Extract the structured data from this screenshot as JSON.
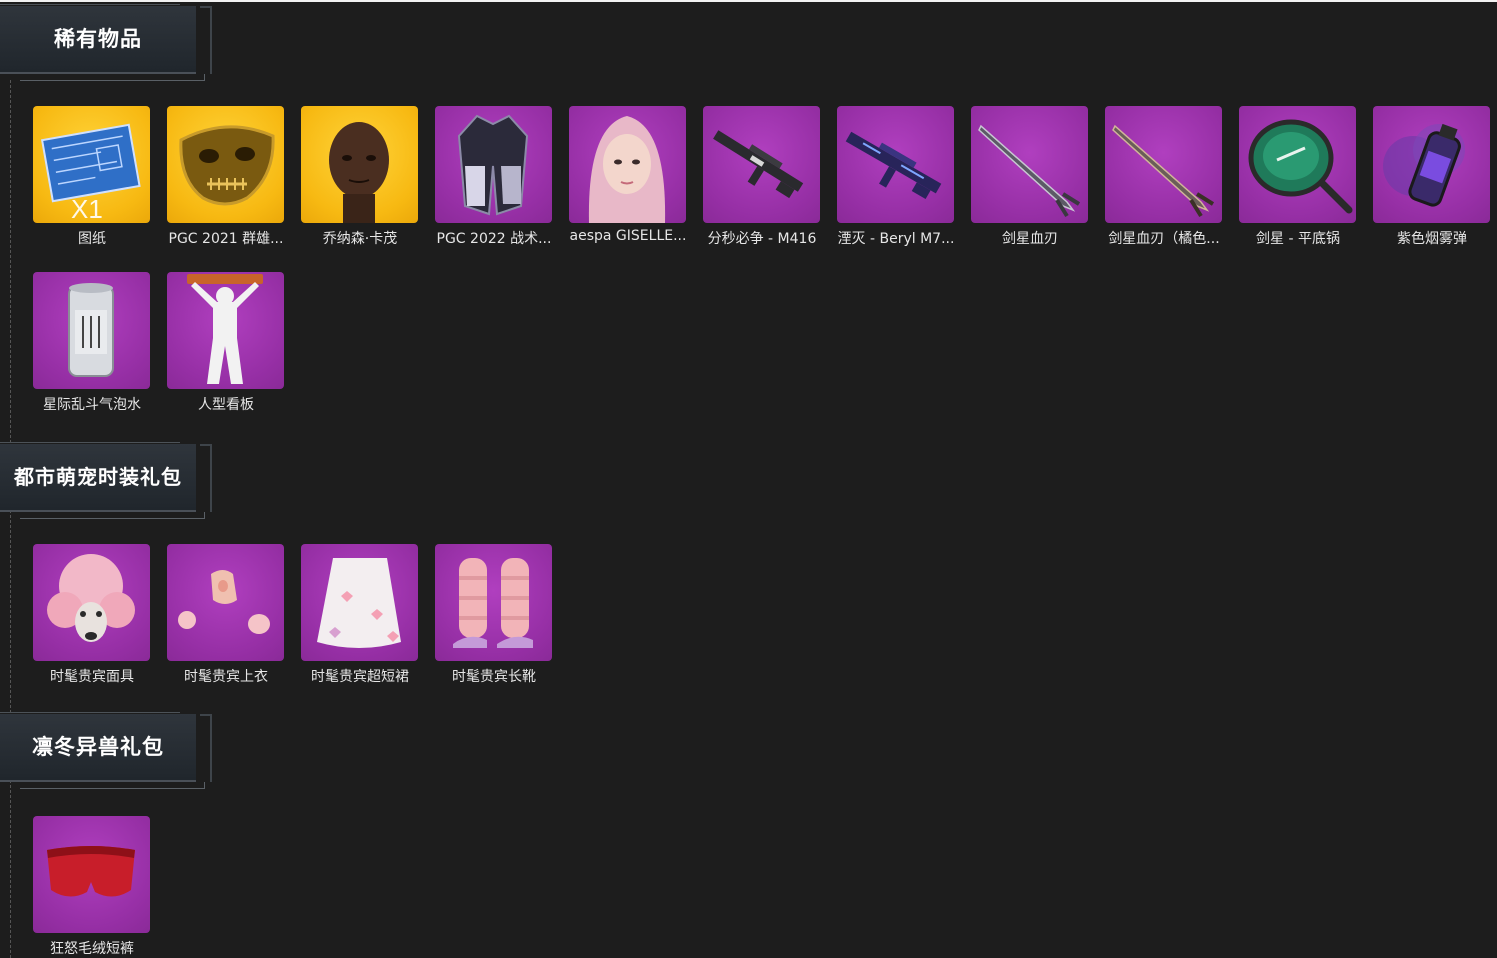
{
  "sections": [
    {
      "title": "稀有物品",
      "items": [
        {
          "label": "图纸",
          "icon": "blueprint-icon",
          "bg": "gold",
          "qty": "X1"
        },
        {
          "label": "PGC 2021 群雄...",
          "icon": "gold-mask-icon",
          "bg": "gold"
        },
        {
          "label": "乔纳森·卡茂",
          "icon": "character-head-icon",
          "bg": "gold"
        },
        {
          "label": "PGC 2022 战术...",
          "icon": "jacket-icon",
          "bg": "purple"
        },
        {
          "label": "aespa GISELLE...",
          "icon": "character-portrait-icon",
          "bg": "purple"
        },
        {
          "label": "分秒必争 - M416",
          "icon": "rifle-icon",
          "bg": "purple"
        },
        {
          "label": "湮灭 - Beryl M7...",
          "icon": "rifle-blue-icon",
          "bg": "purple"
        },
        {
          "label": "剑星血刃",
          "icon": "sword-icon",
          "bg": "purple"
        },
        {
          "label": "剑星血刃（橘色...",
          "icon": "sword-orange-icon",
          "bg": "purple"
        },
        {
          "label": "剑星 - 平底锅",
          "icon": "pan-icon",
          "bg": "purple"
        },
        {
          "label": "紫色烟雾弹",
          "icon": "smoke-grenade-icon",
          "bg": "purple"
        },
        {
          "label": "星际乱斗气泡水",
          "icon": "soda-can-icon",
          "bg": "purple"
        },
        {
          "label": "人型看板",
          "icon": "mannequin-icon",
          "bg": "purple"
        }
      ]
    },
    {
      "title": "都市萌宠时装礼包",
      "items": [
        {
          "label": "时髦贵宾面具",
          "icon": "poodle-mask-icon",
          "bg": "purple"
        },
        {
          "label": "时髦贵宾上衣",
          "icon": "fur-top-icon",
          "bg": "purple"
        },
        {
          "label": "时髦贵宾超短裙",
          "icon": "fur-skirt-icon",
          "bg": "purple"
        },
        {
          "label": "时髦贵宾长靴",
          "icon": "fur-boots-icon",
          "bg": "purple"
        }
      ]
    },
    {
      "title": "凛冬异兽礼包",
      "items": [
        {
          "label": "狂怒毛绒短裤",
          "icon": "red-shorts-icon",
          "bg": "purple"
        }
      ]
    }
  ]
}
